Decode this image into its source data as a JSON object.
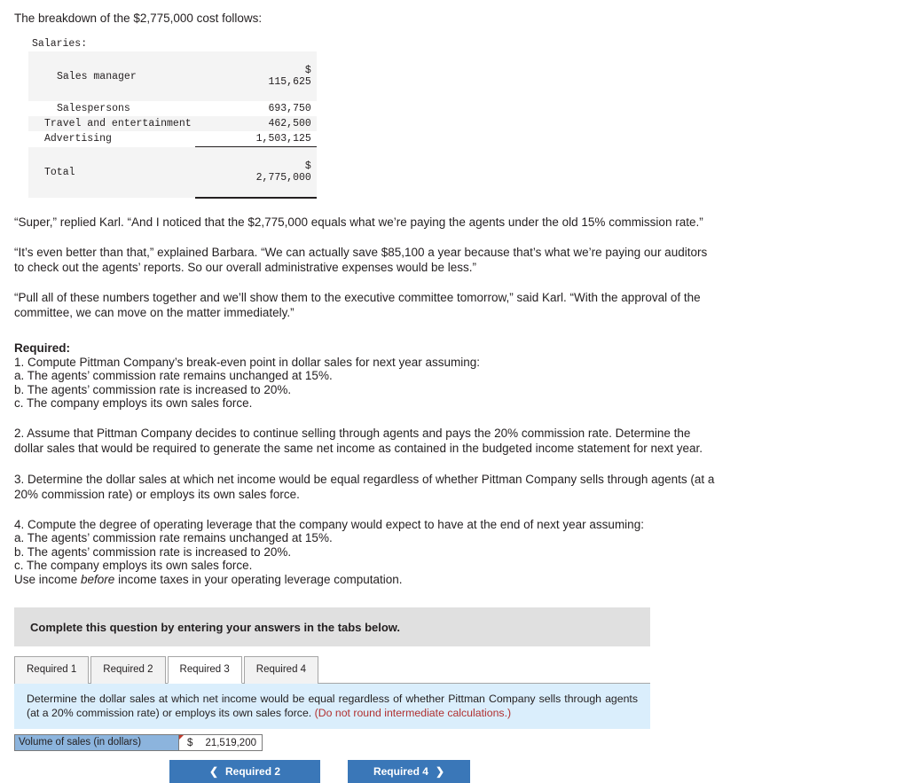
{
  "intro": "The breakdown of the $2,775,000 cost follows:",
  "cost_table": {
    "rows": [
      {
        "label": "Salaries:",
        "indent": 0,
        "currency": "",
        "amount": "",
        "shade": false
      },
      {
        "label": "Sales manager",
        "indent": 2,
        "currency": "$",
        "amount": "115,625",
        "shade": true
      },
      {
        "label": "Salespersons",
        "indent": 2,
        "currency": "",
        "amount": "693,750",
        "shade": false
      },
      {
        "label": "Travel and entertainment",
        "indent": 1,
        "currency": "",
        "amount": "462,500",
        "shade": true
      },
      {
        "label": "Advertising",
        "indent": 1,
        "currency": "",
        "amount": "1,503,125",
        "shade": false
      },
      {
        "label": "Total",
        "indent": 1,
        "currency": "$",
        "amount": "2,775,000",
        "shade": true
      }
    ]
  },
  "narrative": [
    "“Super,” replied Karl. “And I noticed that the $2,775,000 equals what we’re paying the agents under the old 15% commission rate.”",
    "“It’s even better than that,” explained Barbara. “We can actually save $85,100 a year because that’s what we’re paying our auditors to check out the agents’ reports. So our overall administrative expenses would be less.”",
    "“Pull all of these numbers together and we’ll show them to the executive committee tomorrow,” said Karl. “With the approval of the committee, we can move on the matter immediately.”"
  ],
  "required": {
    "title": "Required:",
    "item1": "1. Compute Pittman Company’s break-even point in dollar sales for next year assuming:",
    "item1a": "a. The agents’ commission rate remains unchanged at 15%.",
    "item1b": "b. The agents’ commission rate is increased to 20%.",
    "item1c": "c. The company employs its own sales force.",
    "item2": "2. Assume that Pittman Company decides to continue selling through agents and pays the 20% commission rate. Determine the dollar sales that would be required to generate the same net income as contained in the budgeted income statement for next year.",
    "item3": "3. Determine the dollar sales at which net income would be equal regardless of whether Pittman Company sells through agents (at a 20% commission rate) or employs its own sales force.",
    "item4": "4. Compute the degree of operating leverage that the company would expect to have at the end of next year assuming:",
    "item4a": "a. The agents’ commission rate remains unchanged at 15%.",
    "item4b": "b. The agents’ commission rate is increased to 20%.",
    "item4c": "c. The company employs its own sales force.",
    "item4note_pre": "Use income ",
    "item4note_ital": "before",
    "item4note_post": " income taxes in your operating leverage computation."
  },
  "banner": {
    "text": "Complete this question by entering your answers in the tabs below."
  },
  "tabs": [
    {
      "label": "Required 1",
      "active": false
    },
    {
      "label": "Required 2",
      "active": false
    },
    {
      "label": "Required 3",
      "active": true
    },
    {
      "label": "Required 4",
      "active": false
    }
  ],
  "info_panel": {
    "text": "Determine the dollar sales at which net income would be equal regardless of whether Pittman Company sells through agents (at a 20% commission rate) or employs its own sales force. ",
    "note": "(Do not round intermediate calculations.)"
  },
  "answer": {
    "label": "Volume of sales (in dollars)",
    "currency": "$",
    "value": "21,519,200"
  },
  "nav": {
    "prev_label": "Required 2",
    "prev_icon": "chevron-left-icon",
    "next_label": "Required 4",
    "next_icon": "chevron-right-icon"
  },
  "colors": {
    "banner_gray": "#e0e0e0",
    "panel_blue": "#daeefc",
    "label_blue": "#8cb4dd",
    "button_blue": "#3a77b8",
    "note_red": "#b03030"
  }
}
